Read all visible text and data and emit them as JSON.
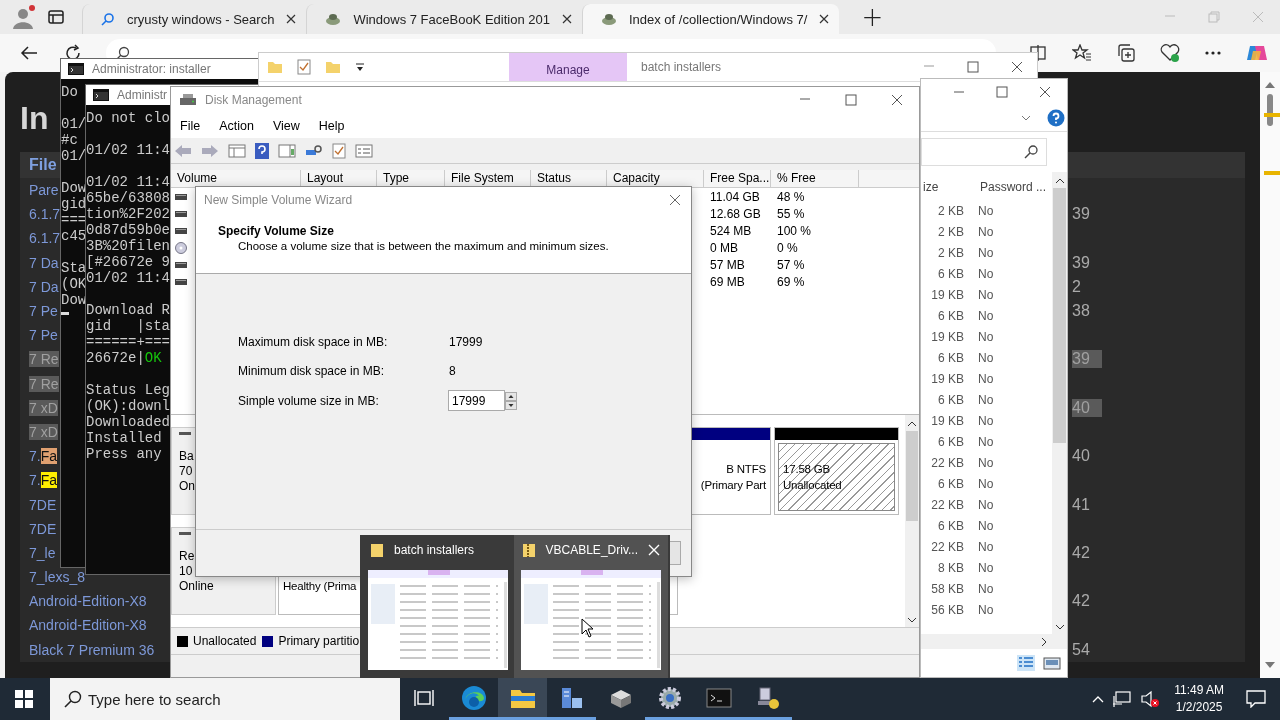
{
  "browser": {
    "tabs": [
      {
        "kind": "search",
        "title": "cryusty windows - Search",
        "selected": false
      },
      {
        "kind": "site",
        "title": "Windows 7 FaceBooK Edition 201",
        "selected": false
      },
      {
        "kind": "site",
        "title": "Index of /collection/Windows 7/",
        "selected": true
      }
    ],
    "new_tab": "+",
    "page": {
      "heading": "In",
      "column": "File",
      "rows": [
        {
          "name": "Pare"
        },
        {
          "name": "6.1.7",
          "tail": "39"
        },
        {
          "name": "6.1.7"
        },
        {
          "name": "7 Da",
          "tail": "39"
        },
        {
          "name": "7 Da",
          "tail": "2"
        },
        {
          "name": "7 Pe",
          "tail": "38"
        },
        {
          "name": "7 Pe"
        },
        {
          "name": "7 Re",
          "color": "#5a5a5a",
          "tail": "39"
        },
        {
          "name": "7 Re",
          "color": "#5a5a5a"
        },
        {
          "name": "7 xD",
          "color": "#5a5a5a",
          "tail": "40"
        },
        {
          "name": "7 xD",
          "color": "#5a5a5a"
        },
        {
          "name": "7.",
          "match": "Fa",
          "color": "#e0a070",
          "tail": "40"
        },
        {
          "name": "7.",
          "match": "Fa",
          "color": "#ffef00"
        },
        {
          "name": "7DE",
          "tail": "41"
        },
        {
          "name": "7DE"
        },
        {
          "name": "7_le",
          "tail": "42"
        },
        {
          "name": "7_lexs_8"
        },
        {
          "name": "Android-Edition-X8",
          "tail": "42"
        },
        {
          "name": "Android-Edition-X8"
        },
        {
          "name": "Black 7 Premium 36",
          "tail": "54"
        }
      ]
    }
  },
  "cmd_windows": [
    {
      "title": "Administrator: installer",
      "blocks": [
        [
          {
            "text": "Do"
          }
        ],
        [
          {
            "text": "01/"
          },
          {
            "text": "#c"
          },
          {
            "text": "01/"
          }
        ],
        [
          {
            "text": "Dow"
          },
          {
            "text": "gid"
          },
          {
            "text": "==="
          },
          {
            "text": "c45"
          }
        ],
        [
          {
            "text": "Sta"
          },
          {
            "text": "(OK"
          },
          {
            "text": "Dow"
          }
        ]
      ]
    },
    {
      "title": "Administr",
      "blocks": [
        [
          {
            "text": "Do not clo"
          }
        ],
        [
          {
            "text": "01/02 11:4"
          }
        ],
        [
          {
            "text": "01/02 11:4"
          },
          {
            "text": "65be/63808"
          },
          {
            "text": "tion%2F202"
          },
          {
            "text": "0d87d59b0e"
          },
          {
            "text": "3B%20filen"
          },
          {
            "text": "[#26672e 9"
          },
          {
            "text": "01/02 11:4"
          }
        ],
        [
          {
            "text": "Download R"
          },
          {
            "text": "gid   |sta"
          },
          {
            "text": "======+==="
          },
          {
            "text": "26672e|",
            "status": "OK",
            "color": "#16c60c"
          }
        ],
        [
          {
            "text": "Status Leg"
          },
          {
            "text": "(OK):downl"
          },
          {
            "text": "Downloaded"
          },
          {
            "text": "Installed"
          },
          {
            "text": "Press any"
          }
        ]
      ]
    }
  ],
  "explorer_back": {
    "ribbon_tab": "Manage",
    "title": "batch installers"
  },
  "explorer_front": {
    "columns": [
      "ize",
      "Password ..."
    ],
    "rows": [
      {
        "size": "2 KB",
        "password": "No"
      },
      {
        "size": "2 KB",
        "password": "No"
      },
      {
        "size": "2 KB",
        "password": "No"
      },
      {
        "size": "6 KB",
        "password": "No"
      },
      {
        "size": "19 KB",
        "password": "No"
      },
      {
        "size": "6 KB",
        "password": "No"
      },
      {
        "size": "19 KB",
        "password": "No"
      },
      {
        "size": "6 KB",
        "password": "No"
      },
      {
        "size": "19 KB",
        "password": "No"
      },
      {
        "size": "6 KB",
        "password": "No"
      },
      {
        "size": "19 KB",
        "password": "No"
      },
      {
        "size": "6 KB",
        "password": "No"
      },
      {
        "size": "22 KB",
        "password": "No"
      },
      {
        "size": "6 KB",
        "password": "No"
      },
      {
        "size": "22 KB",
        "password": "No"
      },
      {
        "size": "6 KB",
        "password": "No"
      },
      {
        "size": "22 KB",
        "password": "No"
      },
      {
        "size": "8 KB",
        "password": "No"
      },
      {
        "size": "58 KB",
        "password": "No"
      },
      {
        "size": "56 KB",
        "password": "No"
      }
    ]
  },
  "disk_management": {
    "title": "Disk Management",
    "menu": [
      "File",
      "Action",
      "View",
      "Help"
    ],
    "columns": [
      "Volume",
      "Layout",
      "Type",
      "File System",
      "Status",
      "Capacity",
      "Free Spa...",
      "% Free"
    ],
    "volumes": [
      {
        "kind": "disk",
        "free": "11.04 GB",
        "pct": "48 %"
      },
      {
        "kind": "disk",
        "free": "12.68 GB",
        "pct": "55 %"
      },
      {
        "kind": "disk",
        "free": "524 MB",
        "pct": "100 %"
      },
      {
        "kind": "cd",
        "free": "0 MB",
        "pct": "0 %"
      },
      {
        "kind": "disk",
        "free": "57 MB",
        "pct": "57 %"
      },
      {
        "kind": "disk",
        "free": "69 MB",
        "pct": "69 %"
      }
    ],
    "disks": [
      {
        "label": [
          "Ba",
          "70",
          "On"
        ],
        "partitions": [
          {
            "kind": "primary",
            "lines": [
              "B NTFS",
              "(Primary Part"
            ]
          },
          {
            "kind": "unallocated",
            "lines": [
              "17.58 GB",
              "Unallocated"
            ]
          }
        ]
      },
      {
        "label": [
          "Re",
          "10",
          "Online"
        ],
        "partitions": [
          {
            "kind": "primary",
            "lines": [
              "Healthy (Prima"
            ]
          }
        ]
      }
    ],
    "legend": [
      {
        "label": "Unallocated",
        "color": "#000000"
      },
      {
        "label": "Primary partitio",
        "color": "#000080"
      }
    ]
  },
  "wizard": {
    "title": "New Simple Volume Wizard",
    "heading": "Specify Volume Size",
    "subheading": "Choose a volume size that is between the maximum and minimum sizes.",
    "fields": [
      {
        "kind": "readout",
        "label": "Maximum disk space in MB:",
        "value": "17999"
      },
      {
        "kind": "readout",
        "label": "Minimum disk space in MB:",
        "value": "8"
      },
      {
        "kind": "spinner",
        "label": "Simple volume size in MB:",
        "value": "17999"
      }
    ]
  },
  "thumbnail_popup": {
    "items": [
      {
        "kind": "folder",
        "title": "batch installers",
        "selected": false
      },
      {
        "kind": "zip",
        "title": "VBCABLE_Driv...",
        "selected": true
      }
    ]
  },
  "taskbar": {
    "search_placeholder": "Type here to search",
    "apps": [
      {
        "kind": "task-view",
        "running": false,
        "selected": false
      },
      {
        "kind": "edge",
        "running": true,
        "selected": false
      },
      {
        "kind": "explorer",
        "running": true,
        "selected": true
      },
      {
        "kind": "server",
        "running": true,
        "selected": false
      },
      {
        "kind": "box",
        "running": false,
        "selected": false
      },
      {
        "kind": "settings",
        "running": true,
        "selected": false
      },
      {
        "kind": "terminal",
        "running": true,
        "selected": false
      },
      {
        "kind": "network",
        "running": true,
        "selected": false
      }
    ],
    "time": "11:49 AM",
    "date": "1/2/2025"
  }
}
